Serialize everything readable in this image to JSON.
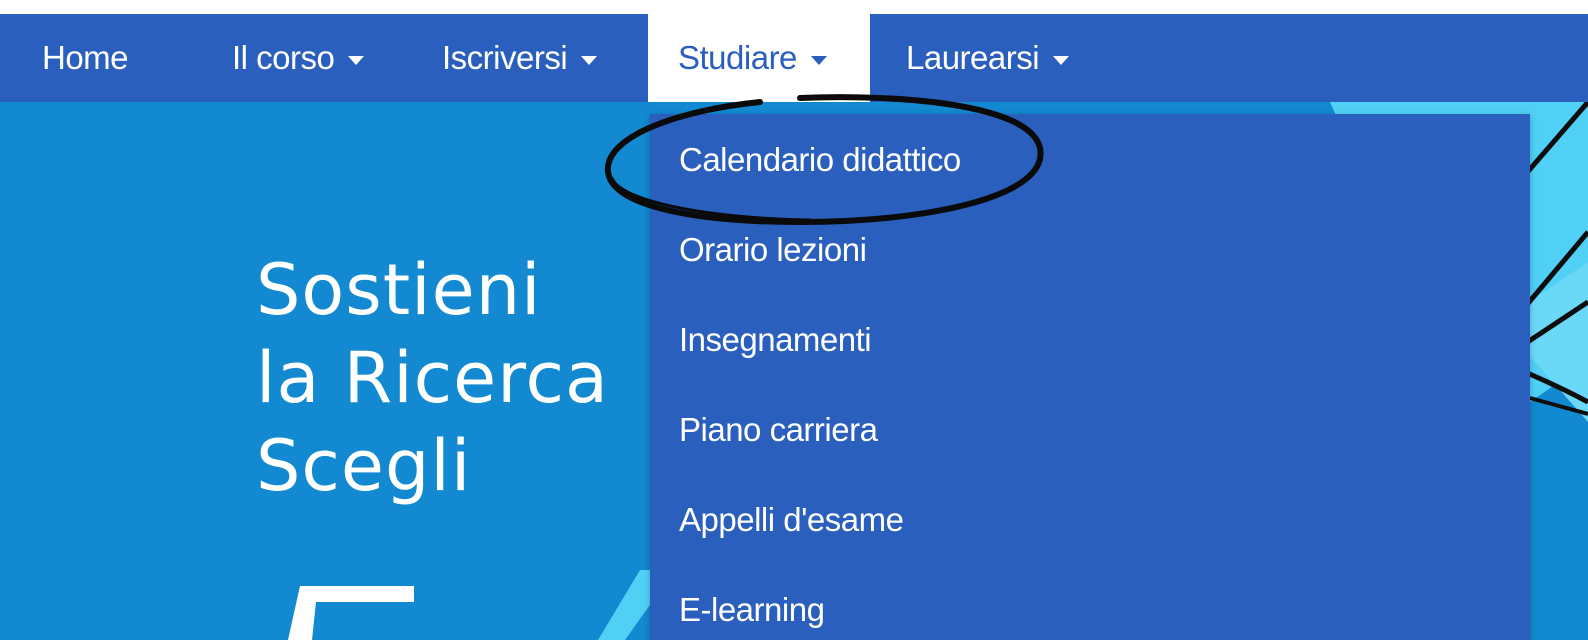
{
  "nav": {
    "items": [
      {
        "label": "Home",
        "has_caret": false
      },
      {
        "label": "Il corso",
        "has_caret": true
      },
      {
        "label": "Iscriversi",
        "has_caret": true
      },
      {
        "label": "Studiare",
        "has_caret": true,
        "active": true
      },
      {
        "label": "Laurearsi",
        "has_caret": true
      }
    ]
  },
  "dropdown": {
    "items": [
      {
        "label": "Calendario didattico",
        "highlighted": true
      },
      {
        "label": "Orario lezioni"
      },
      {
        "label": "Insegnamenti"
      },
      {
        "label": "Piano carriera"
      },
      {
        "label": "Appelli d'esame"
      },
      {
        "label": "E-learning"
      }
    ]
  },
  "hero": {
    "lines": [
      "Sostieni",
      "la Ricerca",
      "Scegli"
    ],
    "partial_text": "5"
  },
  "colors": {
    "nav_bg": "#2a5fbe",
    "hero_bg": "#1289d0",
    "hero_accent": "#4fd0f4",
    "text_on_dark": "#ffffff",
    "annotation_ink": "#0a0a0a"
  }
}
